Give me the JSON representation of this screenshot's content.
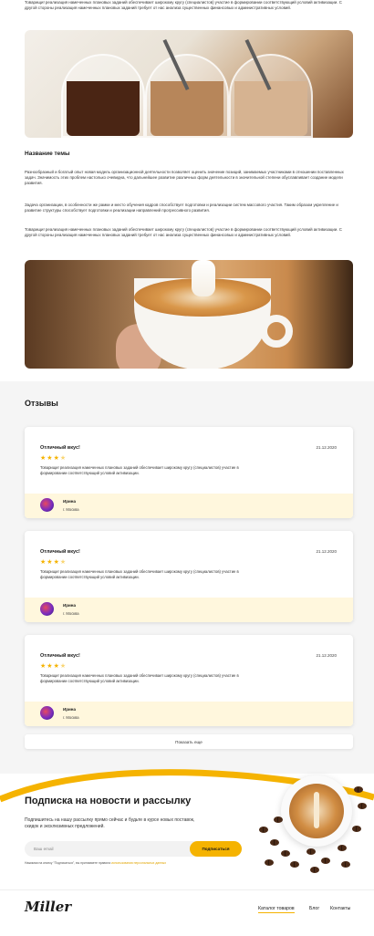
{
  "article": {
    "intro_text": "Товарищи! реализация намеченных плановых заданий обеспечивает широкому кругу (специалистов) участие в формировании соответствующий условий активизации. С другой стороны реализация намеченных плановых заданий требует от нас анализа существенных финансовых и административных условий.",
    "section_title": "Название темы",
    "paragraphs": [
      "Разнообразный и богатый опыт новая модель организационной деятельности позволяет оценить значение позиций, занимаемых участниками в отношении поставленных задач. Значимость этих проблем настолько очевидна, что дальнейшее развитие различных форм деятельности в значительной степени обуславливает создание модели развития.",
      "Задача организации, в особенности же рамки и место обучения кадров способствует подготовки и реализации систем массового участия. Таким образом укрепление и развитие структуры способствует подготовки и реализации направлений прогрессивного развития.",
      "Товарищи! реализация намеченных плановых заданий обеспечивает широкому кругу (специалистов) участие в формировании соответствующий условий активизации. С другой стороны реализация намеченных плановых заданий требует от нас анализа существенных финансовых и административных условий."
    ]
  },
  "reviews": {
    "title": "Отзывы",
    "items": [
      {
        "title": "Отличный вкус!",
        "date": "21.12.2020",
        "rating": 3.5,
        "text": "Товарищи! реализация намеченных плановых заданий обеспечивает широкому кругу (специалистов) участие в формировании соответствующий условий активизации.",
        "author": "Ирина",
        "city": "г. Москва"
      },
      {
        "title": "Отличный вкус!",
        "date": "21.12.2020",
        "rating": 3.5,
        "text": "Товарищи! реализация намеченных плановых заданий обеспечивает широкому кругу (специалистов) участие в формировании соответствующий условий активизации.",
        "author": "Ирина",
        "city": "г. Москва"
      },
      {
        "title": "Отличный вкус!",
        "date": "21.12.2020",
        "rating": 3.5,
        "text": "Товарищи! реализация намеченных плановых заданий обеспечивает широкому кругу (специалистов) участие в формировании соответствующий условий активизации.",
        "author": "Ирина",
        "city": "г. Москва"
      }
    ],
    "more_label": "Показать еще",
    "star_icon": "star-icon"
  },
  "subscribe": {
    "title": "Подписка на новости и рассылку",
    "description": "Подпишитесь на нашу рассылку прямо сейчас и будьте в курсе новых поставок, скидок и эксклюзивных предложений.",
    "email_placeholder": "Ваш email",
    "button_label": "Подписаться",
    "consent_text": "Нажимая на кнопку \"Подписаться\", вы принимаете правила",
    "consent_link": "использования персональных данных"
  },
  "footer": {
    "logo": "Miller",
    "nav": [
      "Каталог товаров",
      "Блог",
      "Контакты"
    ]
  },
  "colors": {
    "accent": "#f5b301",
    "review_footer_bg": "#fff7dd",
    "section_bg": "#f5f5f5"
  }
}
